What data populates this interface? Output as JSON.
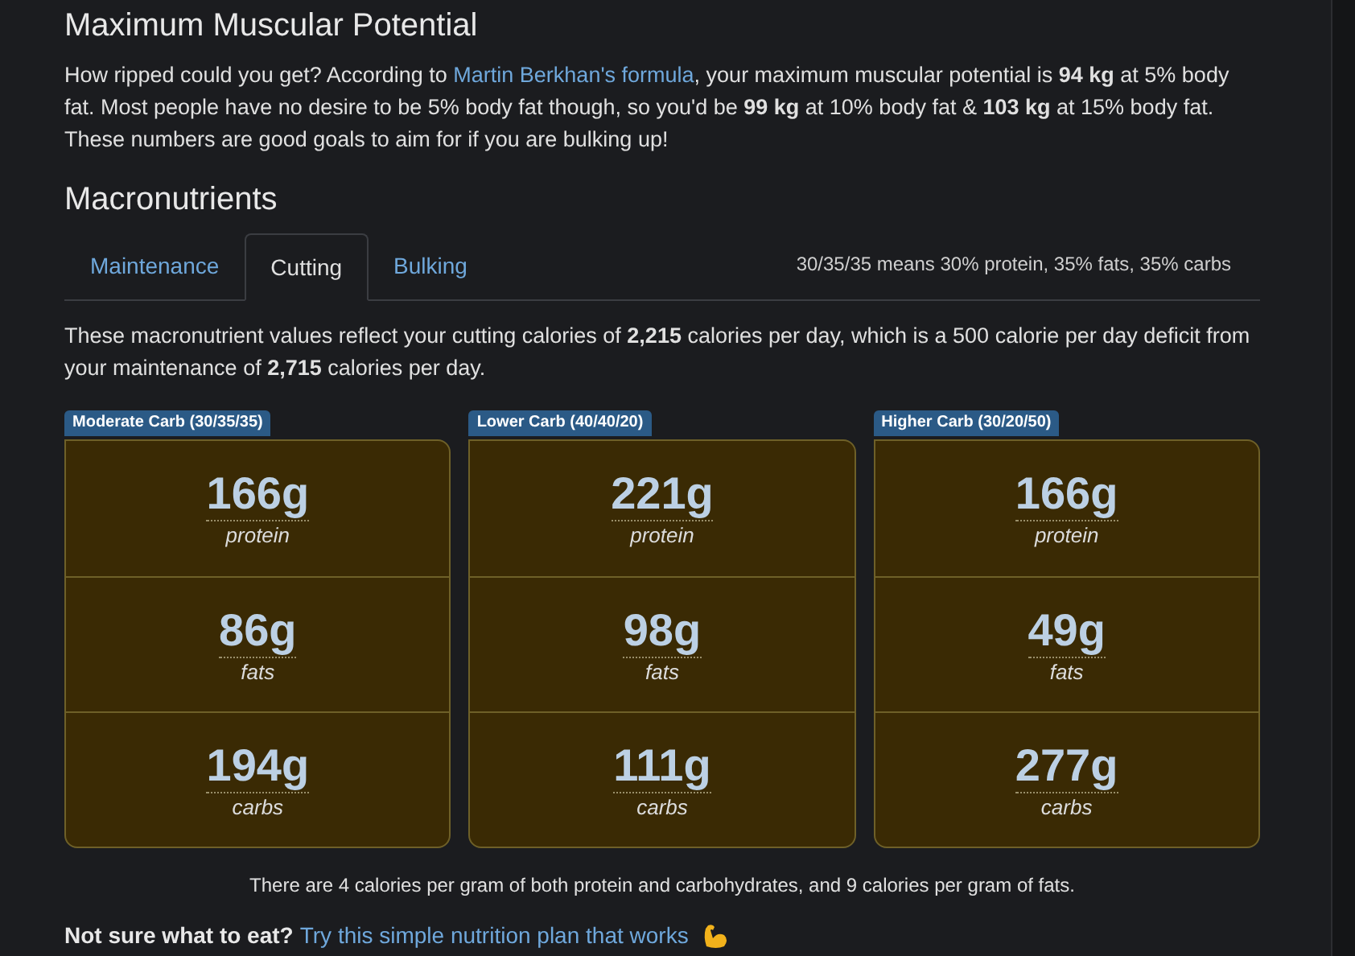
{
  "heading": "Maximum Muscular Potential",
  "intro": {
    "before": "How ripped could you get? According to ",
    "link": "Martin Berkhan's formula",
    "after": ", your maximum muscular potential is **94 kg** at 5% body fat. Most people have no desire to be 5% body fat though, so you'd be **99 kg** at 10% body fat & **103 kg** at 15% body fat. These numbers are good goals to aim for if you are bulking up!"
  },
  "macro_heading": "Macronutrients",
  "tabs": [
    {
      "label": "Maintenance",
      "selected": false
    },
    {
      "label": "Cutting",
      "selected": true
    },
    {
      "label": "Bulking",
      "selected": false
    }
  ],
  "tab_note": "30/35/35 means 30% protein, 35% fats, 35% carbs",
  "summary": "These macronutrient values reflect your cutting calories of **2,215** calories per day, which is a 500 calorie per day deficit from your maintenance of **2,715** calories per day.",
  "plans": [
    {
      "title": "Moderate Carb (30/35/35)",
      "rows": [
        {
          "value": "166g",
          "label": "protein"
        },
        {
          "value": "86g",
          "label": "fats"
        },
        {
          "value": "194g",
          "label": "carbs"
        }
      ]
    },
    {
      "title": "Lower Carb (40/40/20)",
      "rows": [
        {
          "value": "221g",
          "label": "protein"
        },
        {
          "value": "98g",
          "label": "fats"
        },
        {
          "value": "111g",
          "label": "carbs"
        }
      ]
    },
    {
      "title": "Higher Carb (30/20/50)",
      "rows": [
        {
          "value": "166g",
          "label": "protein"
        },
        {
          "value": "49g",
          "label": "fats"
        },
        {
          "value": "277g",
          "label": "carbs"
        }
      ]
    }
  ],
  "footnote": "There are 4 calories per gram of both protein and carbohydrates, and 9 calories per gram of fats.",
  "cta": {
    "question": "Not sure what to eat?",
    "link": "Try this simple nutrition plan that works"
  }
}
